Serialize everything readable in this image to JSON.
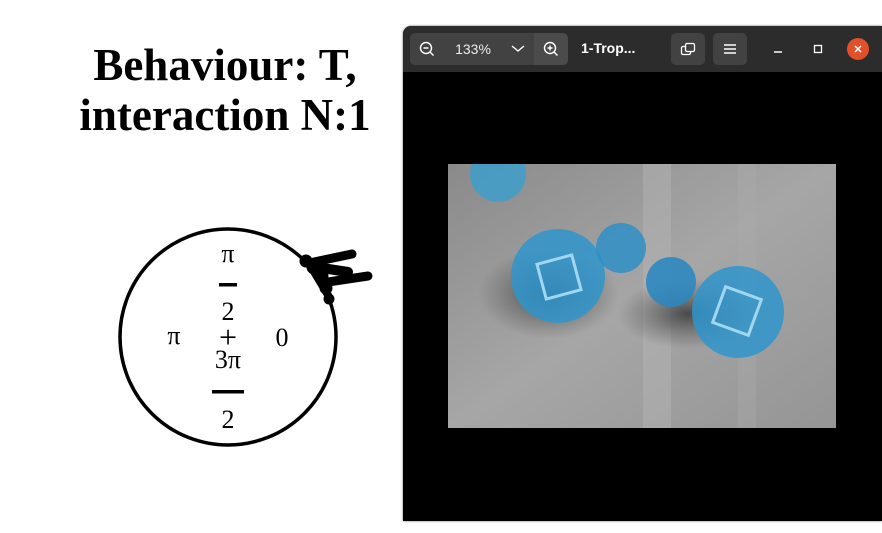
{
  "figure": {
    "title_line1": "Behaviour: T,",
    "title_line2": "interaction N:1",
    "polar_labels": {
      "top": "π",
      "top_denominator": "2",
      "left": "π",
      "right": "0",
      "bottom": "3π",
      "bottom_denominator": "2",
      "plus": "+"
    }
  },
  "viewer": {
    "zoom_level": "133%",
    "document_title": "1-Trop...",
    "accent_close_color": "#e0502a",
    "icons": {
      "zoom_out": "zoom-out-icon",
      "zoom_menu": "chevron-down-icon",
      "zoom_in": "zoom-in-icon",
      "rotate": "rotate-icon",
      "menu": "hamburger-menu-icon",
      "minimize": "minimize-icon",
      "maximize": "maximize-icon",
      "close": "close-icon"
    }
  }
}
